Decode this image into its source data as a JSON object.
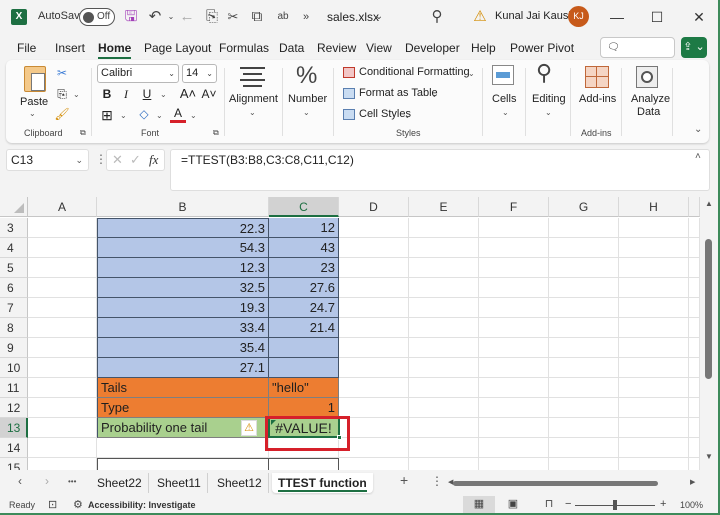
{
  "titlebar": {
    "app_icon": "excel-logo-icon",
    "app_icon_letter": "X",
    "autosave_label": "AutoSave",
    "autosave_state": "Off",
    "filename": "sales.xlsx",
    "filename_chevron": "⌄",
    "user_name": "Kunal Jai Kaushik",
    "user_initials": "KJ",
    "quick_access": [
      {
        "name": "save-icon",
        "glyph": "🖫"
      },
      {
        "name": "undo-icon",
        "glyph": "↶"
      },
      {
        "name": "redo-icon",
        "glyph": "←"
      },
      {
        "name": "copy-icon",
        "glyph": "⎘"
      },
      {
        "name": "cut-icon",
        "glyph": "✂"
      },
      {
        "name": "screenshot-icon",
        "glyph": "⧉"
      },
      {
        "name": "spelling-icon",
        "glyph": "ab"
      },
      {
        "name": "more-commands-icon",
        "glyph": "»"
      }
    ],
    "search_glyph": "⚲",
    "warning_glyph": "⚠",
    "minimize_glyph": "—",
    "maximize_glyph": "☐",
    "close_glyph": "✕"
  },
  "menu": {
    "tabs": [
      "File",
      "Insert",
      "Home",
      "Page Layout",
      "Formulas",
      "Data",
      "Review",
      "View",
      "Developer",
      "Help",
      "Power Pivot"
    ],
    "active_tab": "Home",
    "comments_label": "Comments",
    "comments_glyph": "🗨",
    "share_glyph": "⇪ ⌄"
  },
  "ribbon": {
    "clipboard": {
      "paste_label": "Paste",
      "group_label": "Clipboard"
    },
    "font": {
      "font_name": "Calibri",
      "font_size": "14",
      "group_label": "Font",
      "bold": "B",
      "italic": "I",
      "underline": "U",
      "grow": "A˄",
      "shrink": "A˅",
      "font_color": "A"
    },
    "alignment_label": "Alignment",
    "number_label": "Number",
    "number_glyph": "%",
    "styles": {
      "conditional_formatting": "Conditional Formatting",
      "format_as_table": "Format as Table",
      "cell_styles": "Cell Styles",
      "group_label": "Styles"
    },
    "cells_label": "Cells",
    "editing_label": "Editing",
    "addins": {
      "label": "Add-ins",
      "group_label": "Add-ins"
    },
    "analyze_data_label_1": "Analyze",
    "analyze_data_label_2": "Data",
    "collapse_glyph": "⌄",
    "chevron": "⌄"
  },
  "formula_bar": {
    "name_box": "C13",
    "cancel_glyph": "✕",
    "enter_glyph": "✓",
    "fx_glyph": "fx",
    "formula": "=TTEST(B3:B8,C3:C8,C11,C12)",
    "expand_glyph": "˄"
  },
  "grid": {
    "columns": [
      "A",
      "B",
      "C",
      "D",
      "E",
      "F",
      "G",
      "H"
    ],
    "selected_column": "C",
    "selected_row": "13",
    "rows": [
      {
        "num": "3",
        "b": "22.3",
        "c": "12",
        "style": "blue"
      },
      {
        "num": "4",
        "b": "54.3",
        "c": "43",
        "style": "blue"
      },
      {
        "num": "5",
        "b": "12.3",
        "c": "23",
        "style": "blue"
      },
      {
        "num": "6",
        "b": "32.5",
        "c": "27.6",
        "style": "blue"
      },
      {
        "num": "7",
        "b": "19.3",
        "c": "24.7",
        "style": "blue"
      },
      {
        "num": "8",
        "b": "33.4",
        "c": "21.4",
        "style": "blue"
      },
      {
        "num": "9",
        "b": "35.4",
        "c": "",
        "style": "blue"
      },
      {
        "num": "10",
        "b": "27.1",
        "c": "",
        "style": "blue"
      },
      {
        "num": "11",
        "b": "Tails",
        "c": "\"hello\"",
        "style": "orange"
      },
      {
        "num": "12",
        "b": "Type",
        "c": "1",
        "style": "orange"
      },
      {
        "num": "13",
        "b": "Probability one tail",
        "c": "#VALUE!",
        "style": "green"
      },
      {
        "num": "14",
        "b": "",
        "c": "",
        "style": "none"
      },
      {
        "num": "15",
        "b": "",
        "c": "",
        "style": "boxed"
      }
    ],
    "error_warning_glyph": "⚠"
  },
  "sheets": {
    "nav_prev": "‹",
    "nav_next": "›",
    "more": "•••",
    "tabs": [
      "Sheet22",
      "Sheet11",
      "Sheet12",
      "TTEST function"
    ],
    "active": "TTEST function",
    "add_glyph": "+",
    "options_glyph": "⋮",
    "scroll_left": "◀",
    "scroll_right": "▶"
  },
  "statusbar": {
    "ready": "Ready",
    "accessibility": "Accessibility: Investigate",
    "zoom_minus": "−",
    "zoom_plus": "+",
    "zoom_level": "100%",
    "zoom_fraction": 0.5
  }
}
